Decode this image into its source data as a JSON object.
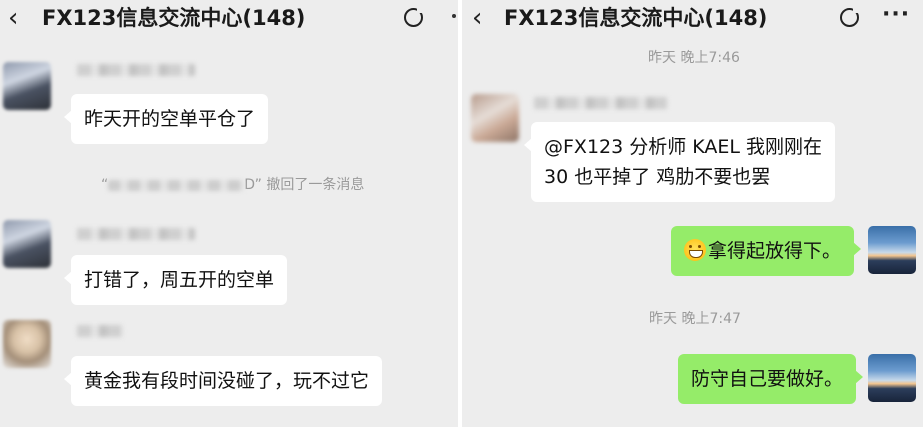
{
  "left": {
    "title": "FX123信息交流中心(148)",
    "messages": [
      {
        "text": "昨天开的空单平仓了"
      },
      {
        "text": "打错了，周五开的空单"
      },
      {
        "text": "黄金我有段时间没碰了，玩不过它"
      }
    ],
    "recall_notice": {
      "prefix": "“",
      "suffix": "D” 撤回了一条消息"
    }
  },
  "right": {
    "title": "FX123信息交流中心(148)",
    "time1": "昨天 晚上7:46",
    "time2": "昨天 晚上7:47",
    "incoming": {
      "line1": "@FX123 分析师 KAEL 我刚刚在",
      "line2": "30 也平掉了 鸡肋不要也罢"
    },
    "outgoing1": "拿得起放得下。",
    "outgoing2": "防守自己要做好。"
  },
  "icons": {
    "back": "back-chevron-icon",
    "voice": "voice-circle-icon",
    "more": "more-dots-icon",
    "emoji": "grinning-face-emoji-icon"
  },
  "colors": {
    "background": "#ededed",
    "bubble_in": "#ffffff",
    "bubble_out": "#95ec69"
  }
}
